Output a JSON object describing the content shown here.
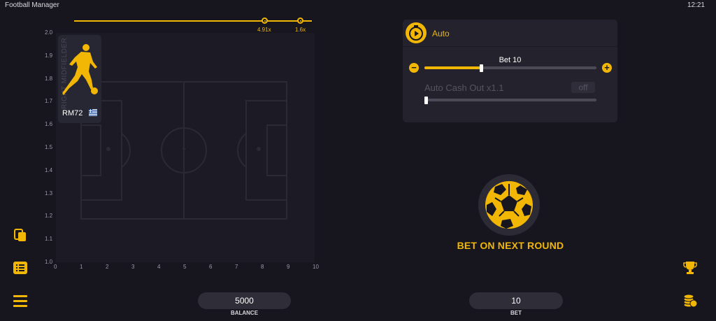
{
  "statusbar": {
    "title": "Football Manager",
    "time": "12:21"
  },
  "history": {
    "items": [
      "4.91x",
      "1.6x"
    ]
  },
  "chart_data": {
    "type": "line",
    "x_ticks": [
      "0",
      "1",
      "2",
      "3",
      "4",
      "5",
      "6",
      "7",
      "8",
      "9",
      "10"
    ],
    "y_ticks": [
      "1.0",
      "1.1",
      "1.2",
      "1.3",
      "1.4",
      "1.5",
      "1.6",
      "1.7",
      "1.8",
      "1.9",
      "2.0"
    ],
    "xlim": [
      0,
      10
    ],
    "ylim": [
      1.0,
      2.0
    ],
    "series": []
  },
  "player_card": {
    "position": "RIGHT MIDFIELDER",
    "code": "RM72",
    "flag": "greece-flag-icon"
  },
  "auto_panel": {
    "auto_label": "Auto",
    "bet_label": "Bet 10",
    "bet_slider_fraction": 0.33,
    "cashout_label": "Auto Cash Out x1.1",
    "cashout_toggle": "off",
    "cashout_slider_fraction": 0.0
  },
  "action": {
    "label": "BET ON NEXT ROUND"
  },
  "footer": {
    "balance_value": "5000",
    "balance_caption": "BALANCE",
    "bet_value": "10",
    "bet_caption": "BET"
  },
  "colors": {
    "accent": "#f2b705",
    "background": "#17161f",
    "panel": "#23222d"
  }
}
